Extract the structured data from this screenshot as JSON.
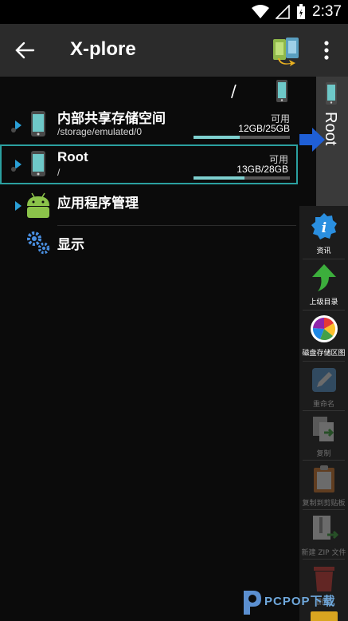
{
  "status_bar": {
    "time": "2:37",
    "icons": [
      "wifi-icon",
      "signal-icon",
      "battery-icon"
    ]
  },
  "app_bar": {
    "title": "X-plore",
    "icons": [
      "back-arrow-icon",
      "pane-switch-icon",
      "more-vert-icon"
    ]
  },
  "path": {
    "text": "/"
  },
  "items": [
    {
      "title": "内部共享存储空间",
      "subtitle": "/storage/emulated/0",
      "available_label": "可用",
      "size": "12GB/25GB",
      "usage_fraction": 0.48
    },
    {
      "title": "Root",
      "subtitle": "/",
      "available_label": "可用",
      "size": "13GB/28GB",
      "usage_fraction": 0.53
    },
    {
      "title": "应用程序管理"
    },
    {
      "title": "显示"
    }
  ],
  "side_tab": {
    "label": "Root"
  },
  "toolbar": [
    {
      "label": "资讯",
      "icon": "info-icon",
      "enabled": true
    },
    {
      "label": "上级目录",
      "icon": "up-arrow-icon",
      "enabled": true
    },
    {
      "label": "磁盘存储区图",
      "icon": "disk-map-icon",
      "enabled": true
    },
    {
      "label": "重命名",
      "icon": "rename-icon",
      "enabled": false
    },
    {
      "label": "复制",
      "icon": "copy-icon",
      "enabled": false
    },
    {
      "label": "复制到剪贴板",
      "icon": "clipboard-icon",
      "enabled": false
    },
    {
      "label": "新建 ZIP 文件",
      "icon": "zip-icon",
      "enabled": false
    },
    {
      "label": "删除",
      "icon": "trash-icon",
      "enabled": false
    }
  ],
  "watermark": {
    "text": "PCPOP下载"
  },
  "colors": {
    "accent": "#2ba0a0",
    "bar_fill": "#7ed0cf",
    "app_bar": "#2b2b2b",
    "background": "#0b0b0b"
  }
}
